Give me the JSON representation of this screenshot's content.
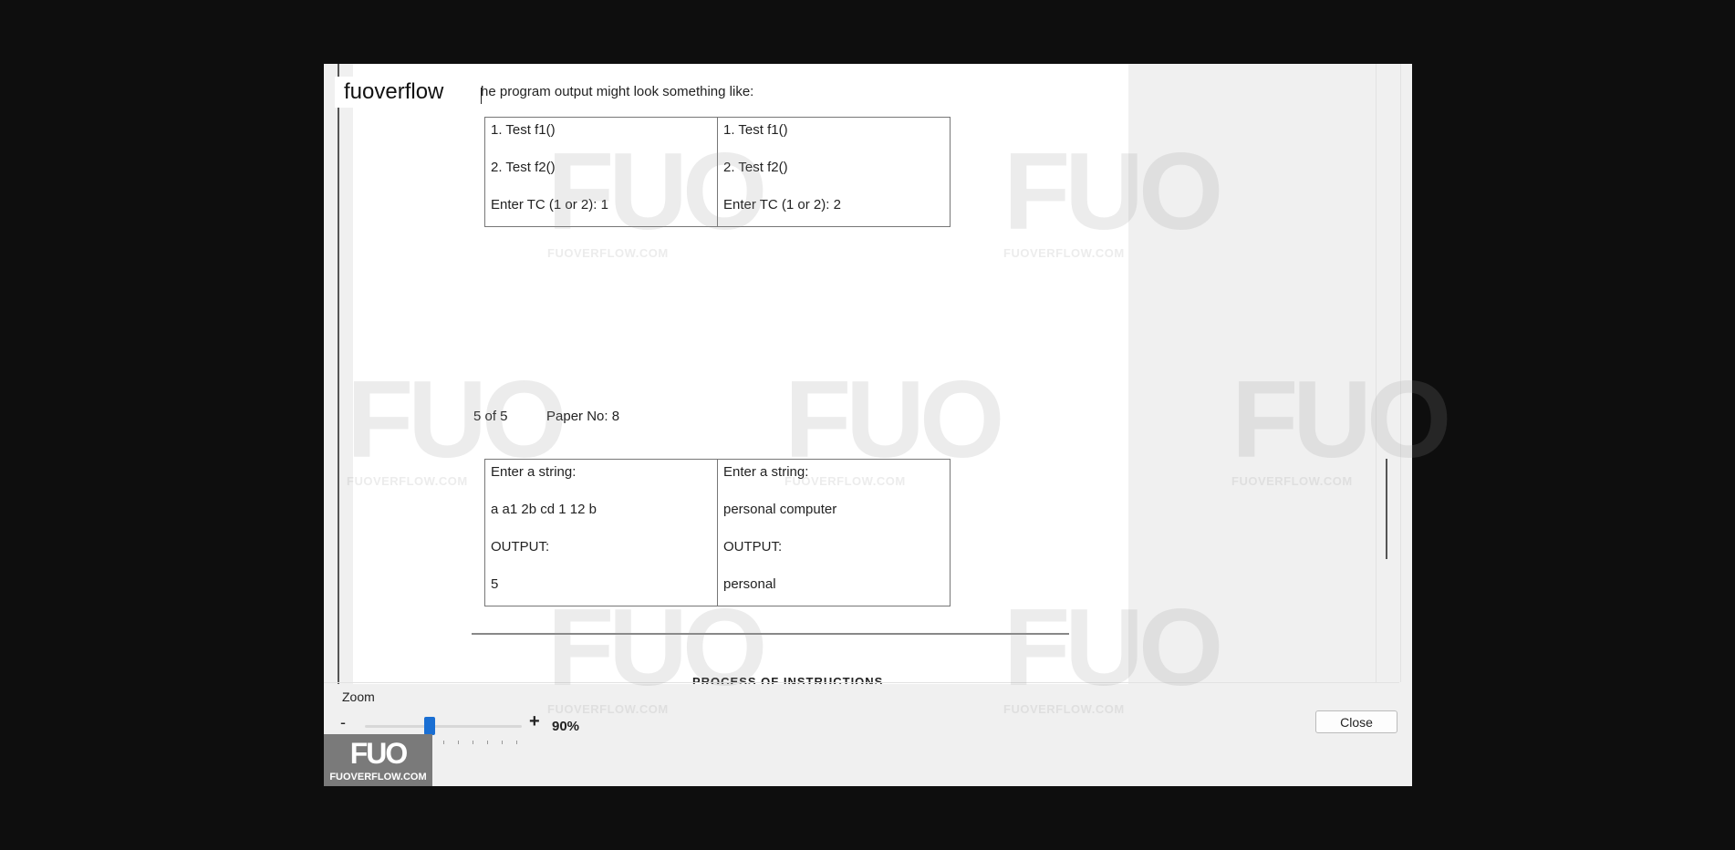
{
  "brand": {
    "name": "fuoverflow"
  },
  "document": {
    "intro_text": "he program output might look something like:",
    "table1": [
      [
        "1. Test f1()",
        "2. Test f2()",
        "Enter TC (1 or 2): 1"
      ],
      [
        "1. Test f1()",
        "2. Test f2()",
        "Enter TC (1 or 2): 2"
      ]
    ],
    "page_number": "5 of 5",
    "paper_no": "Paper No: 8",
    "table2": [
      [
        "Enter a string:",
        "a a1 2b cd 1 12 b",
        "OUTPUT:",
        "5"
      ],
      [
        "Enter a string:",
        "personal computer",
        "OUTPUT:",
        "personal"
      ]
    ],
    "cut_off_heading": "PROCESS OF INSTRUCTIONS"
  },
  "zoom": {
    "label": "Zoom",
    "minus": "-",
    "plus": "+",
    "value": "90%",
    "level_percent": 90
  },
  "buttons": {
    "close": "Close"
  },
  "watermark": {
    "mark": "FUO",
    "url": "FUOVERFLOW.COM"
  },
  "logo": {
    "mark": "FUO",
    "text": "FUOVERFLOW.COM"
  },
  "colors": {
    "accent": "#1a6fd3",
    "background": "#0e0e0e",
    "window": "#f0f0f0"
  }
}
